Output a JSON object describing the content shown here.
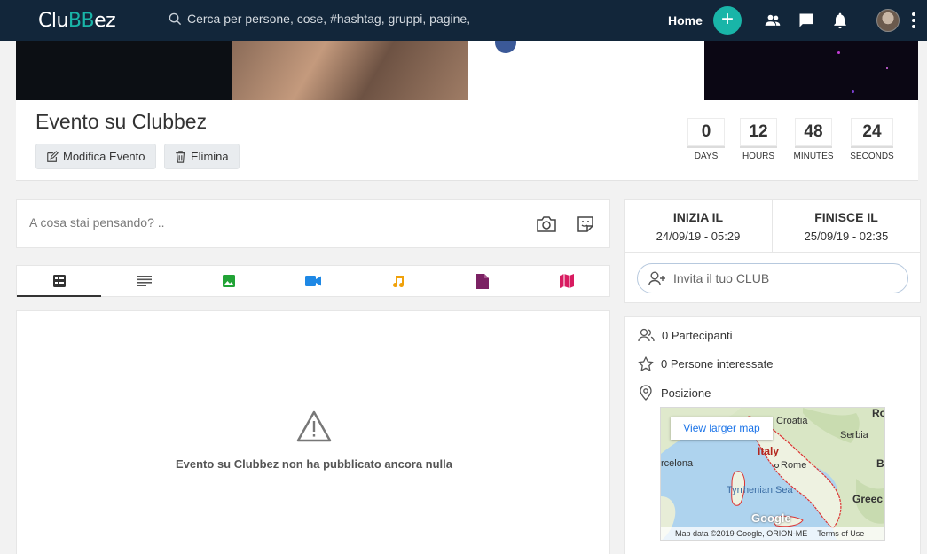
{
  "app": {
    "logo_part1": "Clu",
    "logo_part2": "BB",
    "logo_part3": "ez"
  },
  "nav": {
    "search_placeholder": "Cerca per persone, cose, #hashtag, gruppi, pagine,",
    "home_label": "Home",
    "icons": [
      "plus-icon",
      "people-icon",
      "chat-icon",
      "bell-icon",
      "avatar",
      "more-vert-icon"
    ]
  },
  "event": {
    "title": "Evento su Clubbez",
    "edit_label": "Modifica Evento",
    "delete_label": "Elimina"
  },
  "countdown": [
    {
      "value": "0",
      "label": "DAYS"
    },
    {
      "value": "12",
      "label": "HOURS"
    },
    {
      "value": "48",
      "label": "MINUTES"
    },
    {
      "value": "24",
      "label": "SECONDS"
    }
  ],
  "composer": {
    "placeholder": "A cosa stai pensando? .."
  },
  "tabs": [
    {
      "icon": "feed-icon",
      "color": "#333333",
      "active": true
    },
    {
      "icon": "text-icon",
      "color": "#555555"
    },
    {
      "icon": "image-icon",
      "color": "#21a336"
    },
    {
      "icon": "video-icon",
      "color": "#1e88e5"
    },
    {
      "icon": "music-icon",
      "color": "#f0a10a"
    },
    {
      "icon": "document-icon",
      "color": "#7b2163"
    },
    {
      "icon": "map-icon",
      "color": "#d81b60"
    }
  ],
  "feed": {
    "empty_message": "Evento su Clubbez non ha pubblicato ancora nulla"
  },
  "dates": {
    "start_label": "INIZIA IL",
    "start_value": "24/09/19 - 05:29",
    "end_label": "FINISCE IL",
    "end_value": "25/09/19 - 02:35"
  },
  "invite": {
    "placeholder": "Invita il tuo CLUB"
  },
  "info": {
    "participants": "0 Partecipanti",
    "interested": "0 Persone interessate",
    "location": "Posizione"
  },
  "map": {
    "larger_map": "View larger map",
    "labels": {
      "croatia": "Croatia",
      "serbia": "Serbia",
      "italy": "Italy",
      "rome": "Rome",
      "sea": "Tyrrhenian Sea",
      "barcelona": "rcelona",
      "greece": "Greec",
      "ro": "Ro",
      "b": "B"
    },
    "google": "Google",
    "footer": "Map data ©2019 Google, ORION-ME",
    "terms": "Terms of Use"
  },
  "colors": {
    "topbar": "#12263a",
    "accent": "#19b5a8"
  }
}
